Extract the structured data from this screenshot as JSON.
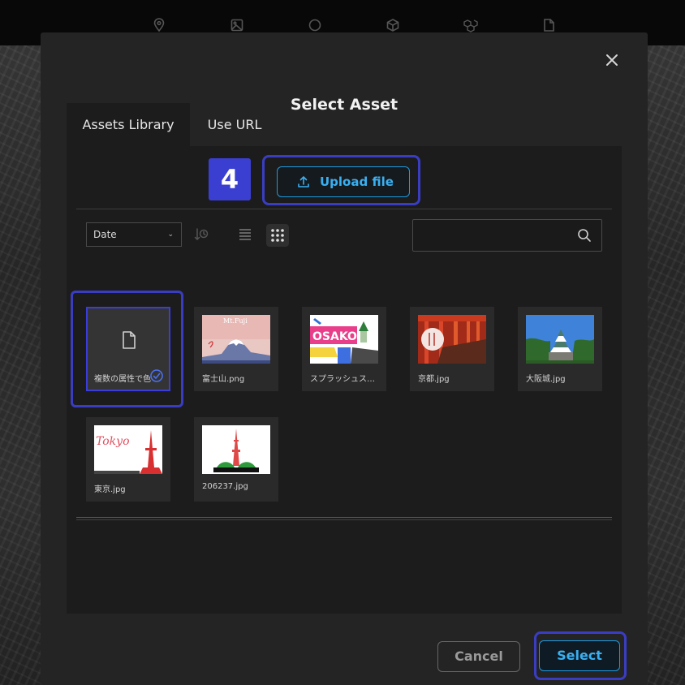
{
  "topbar": {
    "icons": [
      "map-pin-icon",
      "image-icon",
      "circle-icon",
      "cube-icon",
      "cubes-icon",
      "file-icon"
    ]
  },
  "dialog": {
    "title": "Select Asset",
    "close_icon": "close-icon"
  },
  "tabs": [
    {
      "label": "Assets Library",
      "active": true
    },
    {
      "label": "Use URL",
      "active": false
    }
  ],
  "step_badge": "4",
  "upload": {
    "label": "Upload file",
    "icon": "upload-icon"
  },
  "toolbar": {
    "sort_value": "Date",
    "sort_order_icon": "sort-order-icon",
    "view_list_icon": "list-view-icon",
    "view_grid_icon": "grid-view-icon",
    "view_mode": "grid",
    "search_placeholder": "",
    "search_icon": "search-icon"
  },
  "assets": [
    {
      "name": "複数の属性で色…",
      "type": "file",
      "selected": true
    },
    {
      "name": "富士山.png",
      "type": "image",
      "selected": false,
      "thumb_text": "Mt.Fuji"
    },
    {
      "name": "スプラッシュス…",
      "type": "image",
      "selected": false,
      "thumb_text": "OSAKO"
    },
    {
      "name": "京都.jpg",
      "type": "image",
      "selected": false
    },
    {
      "name": "大阪城.jpg",
      "type": "image",
      "selected": false
    },
    {
      "name": "東京.jpg",
      "type": "image",
      "selected": false,
      "thumb_text": "Tokyo"
    },
    {
      "name": "206237.jpg",
      "type": "image",
      "selected": false
    }
  ],
  "footer": {
    "cancel_label": "Cancel",
    "select_label": "Select"
  },
  "colors": {
    "accent": "#3aaff0",
    "highlight": "#3a3dc2",
    "badge": "#3b3fd1"
  }
}
